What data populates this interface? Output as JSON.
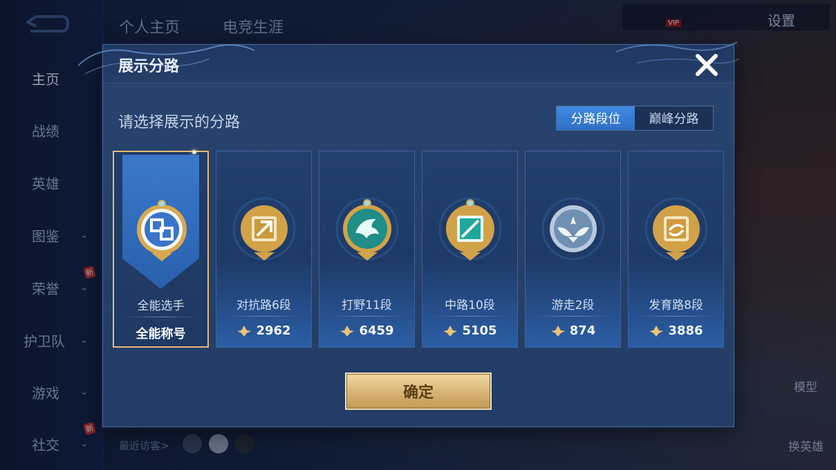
{
  "background": {
    "top_tabs": [
      "个人主页",
      "电竞生涯"
    ],
    "sidebar": {
      "items": [
        {
          "label": "主页",
          "active": true,
          "has_chevron": false,
          "badge": ""
        },
        {
          "label": "战绩",
          "active": false,
          "has_chevron": false,
          "badge": ""
        },
        {
          "label": "英雄",
          "active": false,
          "has_chevron": false,
          "badge": ""
        },
        {
          "label": "图鉴",
          "active": false,
          "has_chevron": true,
          "badge": ""
        },
        {
          "label": "荣誉",
          "active": false,
          "has_chevron": true,
          "badge": "新"
        },
        {
          "label": "护卫队",
          "active": false,
          "has_chevron": true,
          "badge": ""
        },
        {
          "label": "游戏",
          "active": false,
          "has_chevron": true,
          "badge": ""
        },
        {
          "label": "社交",
          "active": false,
          "has_chevron": true,
          "badge": "新"
        }
      ]
    },
    "settings_label": "设置",
    "vip_label": "VIP",
    "recent_visitors_label": "最近访客>",
    "right_buttons": {
      "model": "模型",
      "change_hero": "换英雄"
    }
  },
  "modal": {
    "title": "展示分路",
    "subtitle": "请选择展示的分路",
    "segments": [
      {
        "label": "分路段位",
        "active": true
      },
      {
        "label": "巅峰分路",
        "active": false
      }
    ],
    "cards": [
      {
        "name": "全能选手",
        "footer": "全能称号",
        "selected": true,
        "emblem": "all-round-emblem-icon",
        "accent": "#3a74c9"
      },
      {
        "name": "对抗路6段",
        "footer": "2962",
        "selected": false,
        "emblem": "clash-lane-emblem-icon",
        "accent": "#c89a3c"
      },
      {
        "name": "打野11段",
        "footer": "6459",
        "selected": false,
        "emblem": "jungle-emblem-icon",
        "accent": "#1f8e86"
      },
      {
        "name": "中路10段",
        "footer": "5105",
        "selected": false,
        "emblem": "mid-lane-emblem-icon",
        "accent": "#1fa89a"
      },
      {
        "name": "游走2段",
        "footer": "874",
        "selected": false,
        "emblem": "roam-emblem-icon",
        "accent": "#8fa9c7"
      },
      {
        "name": "发育路8段",
        "footer": "3886",
        "selected": false,
        "emblem": "farm-lane-emblem-icon",
        "accent": "#d19a3e"
      }
    ],
    "confirm_label": "确定",
    "colors": {
      "gold": "#e5bb78",
      "segment_active": "#3f8ae0",
      "panel": "#28436d"
    }
  }
}
